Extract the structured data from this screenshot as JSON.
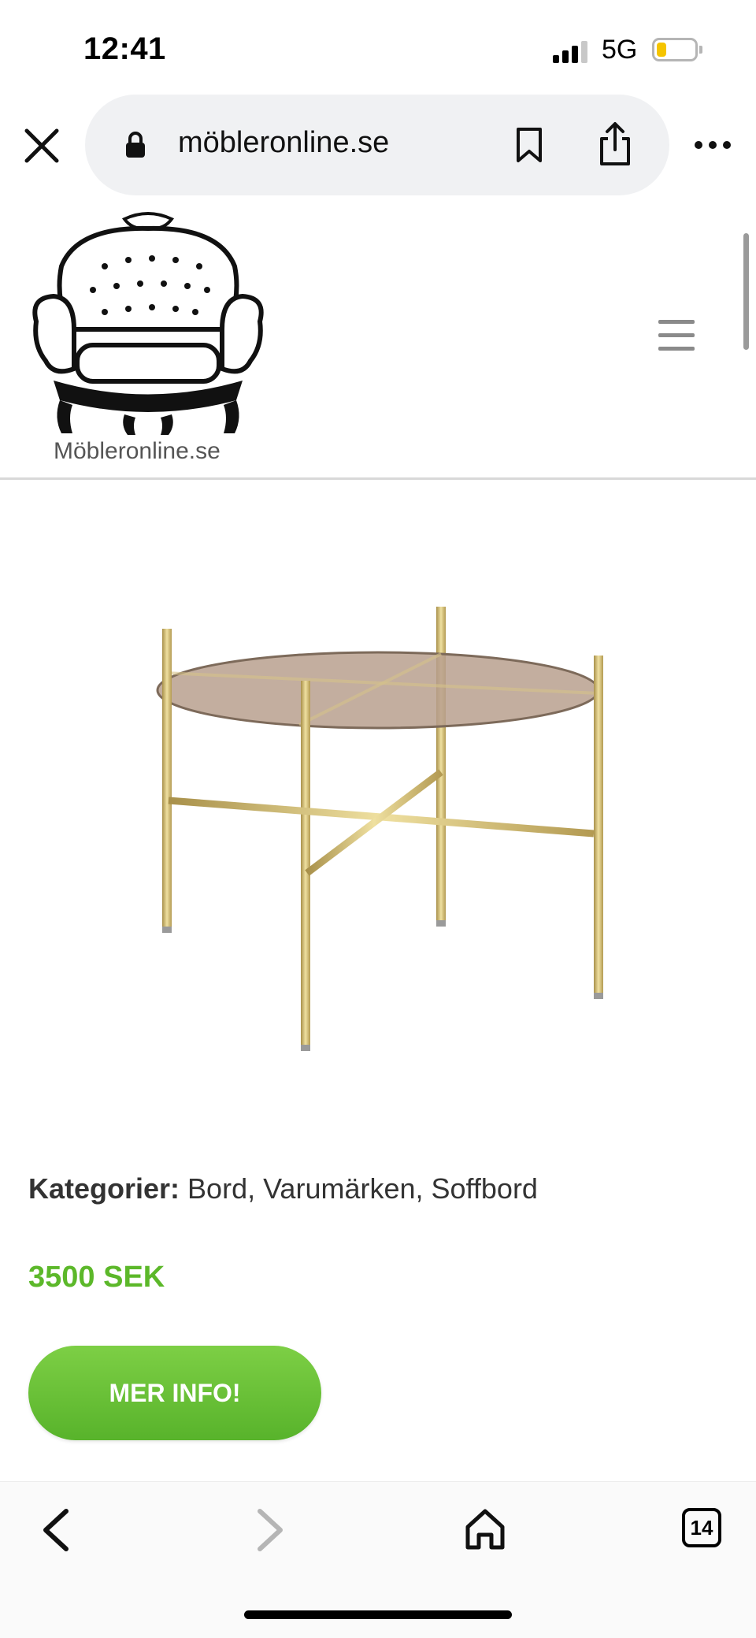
{
  "status_bar": {
    "time": "12:41",
    "network": "5G",
    "battery_level": 0.25,
    "icons": [
      "signal-icon",
      "battery-icon"
    ]
  },
  "browser": {
    "url": "möbleronline.se",
    "icons": [
      "close-icon",
      "lock-icon",
      "bookmark-icon",
      "share-icon",
      "more-icon"
    ]
  },
  "site": {
    "logo_text": "Möbleronline.se",
    "menu_icon": "hamburger-menu-icon"
  },
  "product": {
    "image_description_icon": "glass-coffee-table-image",
    "categories_label": "Kategorier:",
    "categories_value": " Bord, Varumärken, Soffbord",
    "price": "3500 SEK",
    "button_label": "MER INFO!"
  },
  "toolbar": {
    "tabs_count": "14",
    "icons": [
      "back-icon",
      "forward-icon",
      "home-icon",
      "tabs-icon"
    ]
  },
  "colors": {
    "accent_green": "#5cb82a",
    "button_green_top": "#7dcf45",
    "button_green_bottom": "#58b32b",
    "battery_yellow": "#f5c400"
  }
}
